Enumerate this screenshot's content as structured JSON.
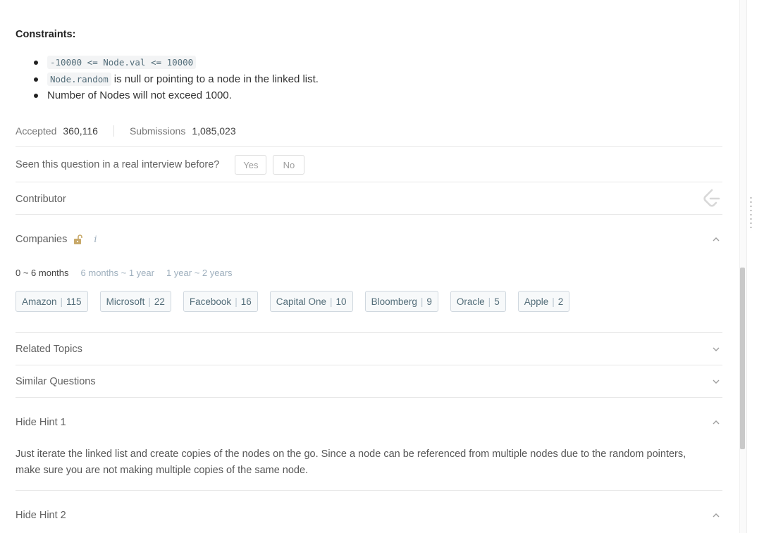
{
  "constraints": {
    "title": "Constraints:",
    "items": [
      {
        "code": "-10000 <= Node.val <= 10000",
        "text": ""
      },
      {
        "code": "Node.random",
        "text": "is null or pointing to a node in the linked list."
      },
      {
        "code": "",
        "text": "Number of Nodes will not exceed 1000."
      }
    ]
  },
  "stats": {
    "accepted_label": "Accepted",
    "accepted_value": "360,116",
    "submissions_label": "Submissions",
    "submissions_value": "1,085,023"
  },
  "interview": {
    "question": "Seen this question in a real interview before?",
    "yes": "Yes",
    "no": "No"
  },
  "contributor": {
    "label": "Contributor"
  },
  "companies": {
    "label": "Companies",
    "info": "i",
    "periods": [
      {
        "label": "0 ~ 6 months",
        "active": true
      },
      {
        "label": "6 months ~ 1 year",
        "active": false
      },
      {
        "label": "1 year ~ 2 years",
        "active": false
      }
    ],
    "tags": [
      {
        "name": "Amazon",
        "count": "115"
      },
      {
        "name": "Microsoft",
        "count": "22"
      },
      {
        "name": "Facebook",
        "count": "16"
      },
      {
        "name": "Capital One",
        "count": "10"
      },
      {
        "name": "Bloomberg",
        "count": "9"
      },
      {
        "name": "Oracle",
        "count": "5"
      },
      {
        "name": "Apple",
        "count": "2"
      }
    ]
  },
  "related_topics": {
    "label": "Related Topics"
  },
  "similar_questions": {
    "label": "Similar Questions"
  },
  "hint1": {
    "label": "Hide Hint 1",
    "text": "Just iterate the linked list and create copies of the nodes on the go. Since a node can be referenced from multiple nodes due to the random pointers, make sure you are not making multiple copies of the same node."
  },
  "hint2": {
    "label": "Hide Hint 2"
  },
  "colors": {
    "lock": "#c8a96a",
    "tag_border": "#d0d8df",
    "muted_period": "#9eafbd"
  }
}
